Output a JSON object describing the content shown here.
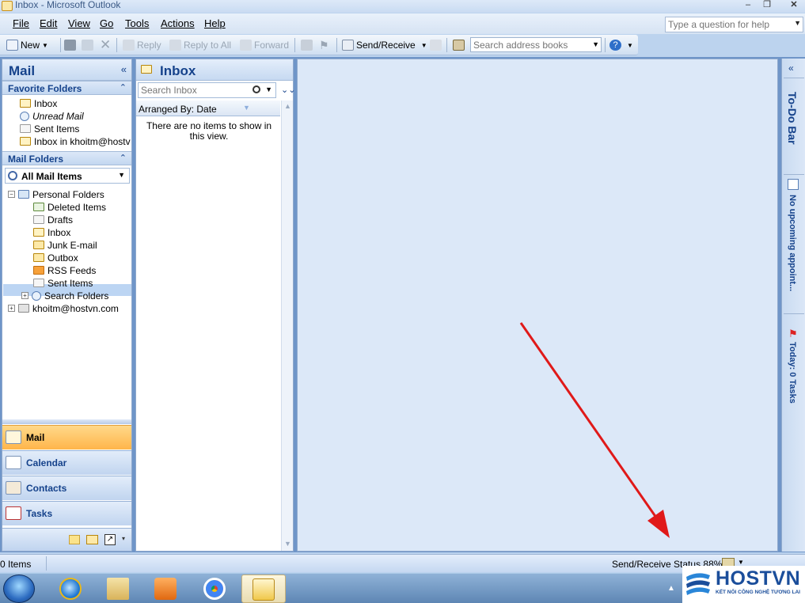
{
  "window": {
    "title": "Inbox - Microsoft Outlook",
    "controls": {
      "minimize": "–",
      "restore": "❐",
      "close": "✕"
    }
  },
  "menubar": {
    "items": [
      "File",
      "Edit",
      "View",
      "Go",
      "Tools",
      "Actions",
      "Help"
    ],
    "help_placeholder": "Type a question for help"
  },
  "toolbar": {
    "new_label": "New",
    "reply_label": "Reply",
    "reply_all_label": "Reply to All",
    "forward_label": "Forward",
    "send_receive_label": "Send/Receive",
    "address_search_placeholder": "Search address books"
  },
  "nav": {
    "title": "Mail",
    "favorites_title": "Favorite Folders",
    "favorites": [
      "Inbox",
      "Unread Mail",
      "Sent Items",
      "Inbox in khoitm@hostvn"
    ],
    "mail_folders_title": "Mail Folders",
    "all_mail_items": "All Mail Items",
    "tree": {
      "root": "Personal Folders",
      "children": [
        "Deleted Items",
        "Drafts",
        "Inbox",
        "Junk E-mail",
        "Outbox",
        "RSS Feeds",
        "Sent Items",
        "Search Folders"
      ],
      "account": "khoitm@hostvn.com"
    },
    "selected_folder": "Inbox",
    "buttons": [
      "Mail",
      "Calendar",
      "Contacts",
      "Tasks"
    ],
    "active_button": "Mail"
  },
  "list": {
    "title": "Inbox",
    "search_placeholder": "Search Inbox",
    "arranged_by": "Arranged By: Date",
    "empty_message": "There are no items to show in this view."
  },
  "todo": {
    "title": "To-Do Bar",
    "appointments": "No upcoming appoint...",
    "tasks": "Today: 0 Tasks"
  },
  "status": {
    "items": "0 Items",
    "send_receive": "Send/Receive Status 88%"
  },
  "watermark": {
    "brand": "HOSTVN",
    "tagline": "KẾT NỐI CÔNG NGHỆ TƯƠNG LAI"
  },
  "colors": {
    "arrow": "#e01919",
    "active_nav": "#ffb54a",
    "accent_text": "#15428b"
  }
}
